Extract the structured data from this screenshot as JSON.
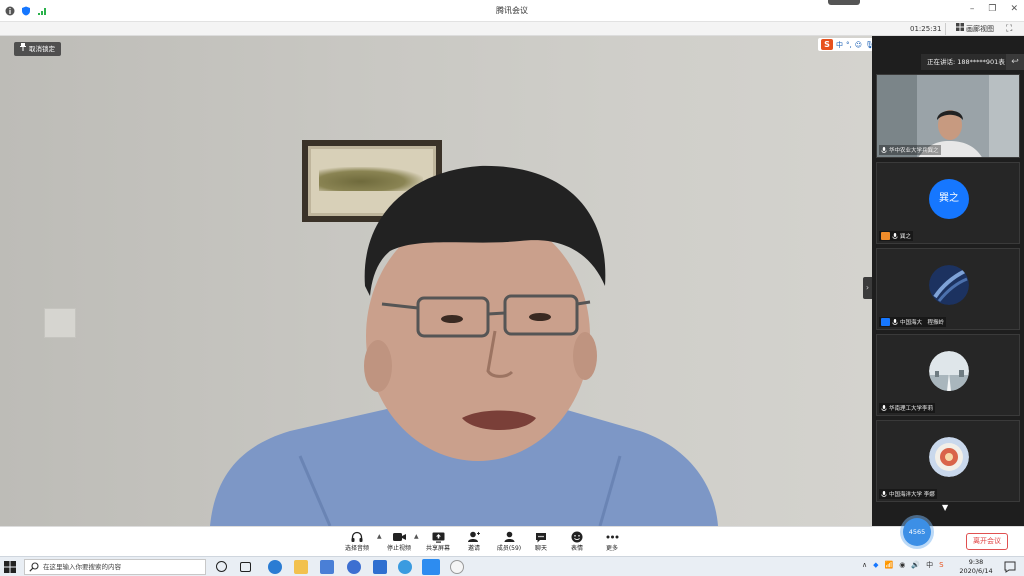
{
  "window": {
    "title": "腾讯会议",
    "timer": "01:25:31",
    "gallery_label": "画廊视图"
  },
  "main_video": {
    "unlock_label": "取消锁定"
  },
  "sidebar": {
    "speaking_label": "正在讲话: 188*****901表",
    "participants": [
      {
        "name": "华中农业大学兵巽之",
        "kind": "video"
      },
      {
        "name": "巽之",
        "kind": "avatar",
        "avatar_text": "巽之",
        "host": true
      },
      {
        "name": "中国海大　程振岭",
        "kind": "avatar-image",
        "cohost": true
      },
      {
        "name": "华南理工大学李莉",
        "kind": "avatar-image"
      },
      {
        "name": "中国海洋大学 李娜",
        "kind": "avatar-image"
      }
    ]
  },
  "controls": [
    {
      "label": "选择音频",
      "icon": "headset-icon"
    },
    {
      "label": "停止视频",
      "icon": "camera-icon"
    },
    {
      "label": "共享屏幕",
      "icon": "share-screen-icon"
    },
    {
      "label": "邀请",
      "icon": "invite-icon"
    },
    {
      "label": "成员(59)",
      "icon": "members-icon"
    },
    {
      "label": "聊天",
      "icon": "chat-icon"
    },
    {
      "label": "表情",
      "icon": "emoji-icon"
    },
    {
      "label": "更多",
      "icon": "more-icon"
    }
  ],
  "leave_label": "离开会议",
  "float_badge": "4565",
  "ime_label": "中",
  "taskbar": {
    "search_placeholder": "在这里输入你要搜索的内容",
    "time": "9:38",
    "date": "2020/6/14"
  },
  "colors": {
    "accent": "#1677ff",
    "leave": "#e04040",
    "ime": "#e8511d"
  }
}
